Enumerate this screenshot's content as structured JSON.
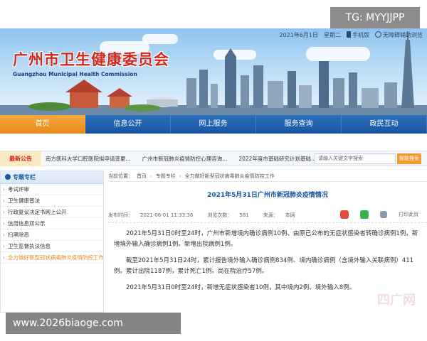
{
  "watermarks": {
    "tg": "TG: MYYJJPP",
    "site": "www.2026biaoge.com",
    "faint": "四广网"
  },
  "topbar": {
    "date": "2021年6月1日",
    "weekday": "星期二",
    "mobile": "手机版",
    "accessible": "无障碍辅助浏览"
  },
  "logo": {
    "cn": "广州市卫生健康委员会",
    "en": "Guangzhou Municipal Health Commission"
  },
  "nav": {
    "items": [
      "首页",
      "信息公开",
      "网上服务",
      "服务查询",
      "政民互动"
    ],
    "active_index": 0
  },
  "notice": {
    "tag": "最新公告",
    "items": [
      "南方医科大学口腔医院拟申请变更...",
      "广州市新冠肺炎疫情防控心理咨询...",
      "2022年度市基础研究计划基础..."
    ],
    "search_placeholder": "请输入关键文字搜索",
    "search_button": "智能搜索"
  },
  "sidebar": {
    "title": "专题专栏",
    "items": [
      "考试评审",
      "卫生健康普法",
      "行政复议决定书网上公开",
      "信用信息双公示",
      "扫黑除恶",
      "卫生监督执法信息",
      "全力做好新型冠状病毒肺炎疫情防控工作"
    ],
    "highlight_index": 6
  },
  "breadcrumb": {
    "label": "当前位置：",
    "items": [
      "首页",
      "专题专栏",
      "全力做好新型冠状病毒肺炎疫情防控工作"
    ]
  },
  "article": {
    "title": "2021年5月31日广州市新冠肺炎疫情情况",
    "publish_label": "发布时间：",
    "publish_time": "2021-06-01 11:33:36",
    "views_label": "浏览次数：",
    "views": "581",
    "source_label": "来源：",
    "source": "本网",
    "print": "打印此页",
    "paragraphs": [
      "2021年5月31日0时至24时，广州市新增境内确诊病例10例、由原已公布的无症状感染者转确诊病例1例，新增境外输入确诊病例1例。新增出院病例1例。",
      "截至2021年5月31日24时，累计报告境外输入确诊病例834例、境内确诊病例（含境外输入关联病例）411例。累计出院1187例，累计死亡1例。尚在院治疗57例。",
      "2021年5月31日0时至24时，新增无症状感染者10例，其中境内2例、境外输入8例。"
    ]
  },
  "colors": {
    "brand_blue": "#1a56a0",
    "accent_orange": "#e8891c",
    "logo_red": "#d0281e"
  }
}
